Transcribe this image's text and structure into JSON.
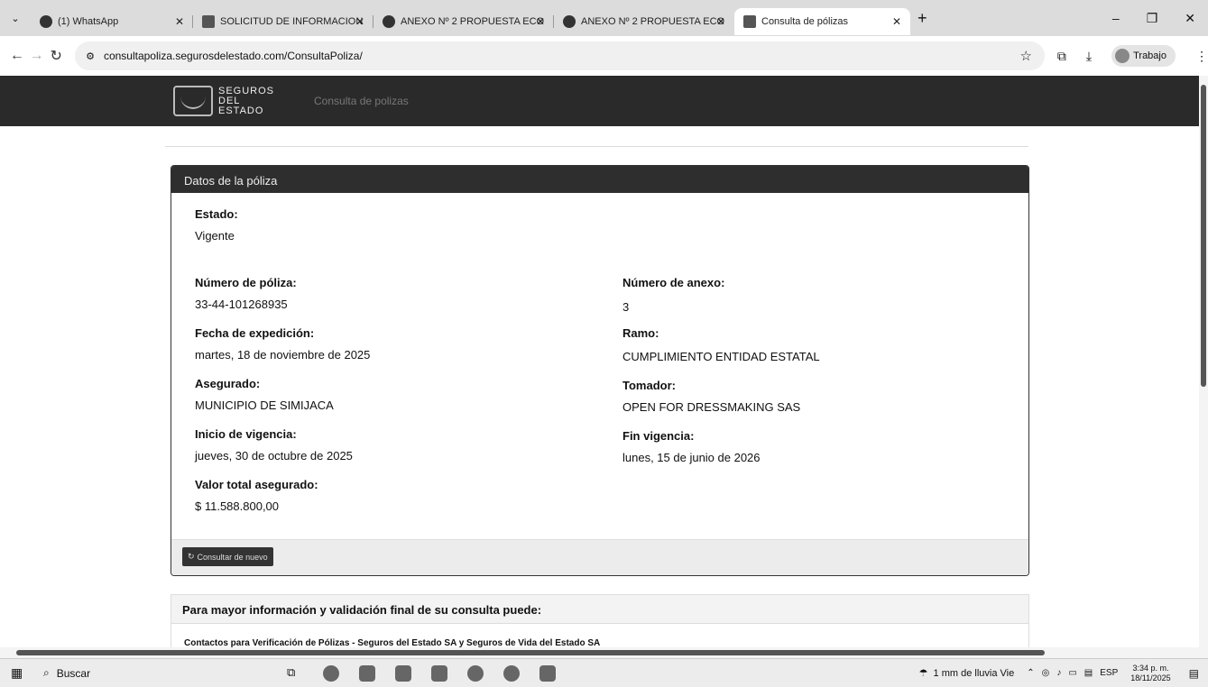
{
  "browser": {
    "tabs": [
      {
        "title": "(1) WhatsApp",
        "icon": "whatsapp-icon"
      },
      {
        "title": "SOLICITUD DE INFORMACION",
        "icon": "gmail-icon"
      },
      {
        "title": "ANEXO Nº 2 PROPUESTA ECO",
        "icon": "globe-icon"
      },
      {
        "title": "ANEXO Nº 2 PROPUESTA ECO",
        "icon": "globe-icon"
      },
      {
        "title": "Consulta de pólizas",
        "icon": "site-icon"
      }
    ],
    "url": "consultapoliza.segurosdelestado.com/ConsultaPoliza/",
    "profile_label": "Trabajo"
  },
  "site": {
    "logo_lines": [
      "SEGUROS",
      "DEL",
      "ESTADO"
    ],
    "nav_link": "Consulta de polizas"
  },
  "policy": {
    "panel_title": "Datos de la póliza",
    "estado_label": "Estado:",
    "estado_value": "Vigente",
    "numero_poliza_label": "Número de póliza:",
    "numero_poliza_value": "33-44-101268935",
    "numero_anexo_label": "Número de anexo:",
    "numero_anexo_value": "3",
    "fecha_expedicion_label": "Fecha de expedición:",
    "fecha_expedicion_value": "martes, 18 de noviembre de 2025",
    "ramo_label": "Ramo:",
    "ramo_value": "CUMPLIMIENTO ENTIDAD ESTATAL",
    "asegurado_label": "Asegurado:",
    "asegurado_value": "MUNICIPIO DE SIMIJACA",
    "tomador_label": "Tomador:",
    "tomador_value": "OPEN FOR DRESSMAKING SAS",
    "inicio_vigencia_label": "Inicio de vigencia:",
    "inicio_vigencia_value": "jueves, 30 de octubre de 2025",
    "fin_vigencia_label": "Fin vigencia:",
    "fin_vigencia_value": "lunes, 15 de junio de 2026",
    "valor_label": "Valor total asegurado:",
    "valor_value": "$ 11.588.800,00",
    "refresh_button": "Consultar de nuevo"
  },
  "info": {
    "heading": "Para mayor información y validación final de su consulta puede:",
    "subheading": "Contactos para Verificación de Pólizas - Seguros del Estado SA y Seguros de Vida del Estado SA"
  },
  "taskbar": {
    "search_label": "Buscar",
    "weather": "1 mm de lluvia Vie",
    "language": "ESP",
    "time": "3:34 p. m.",
    "date": "18/11/2025"
  }
}
